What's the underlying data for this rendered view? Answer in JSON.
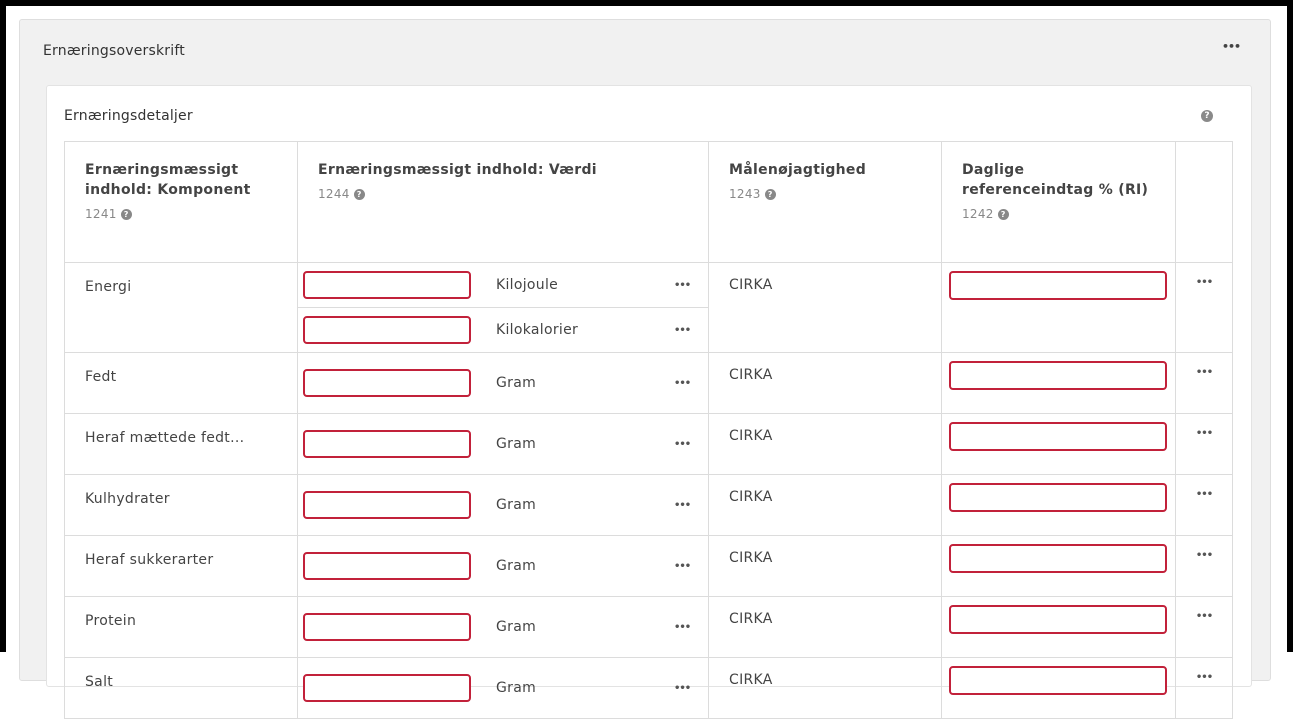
{
  "outer_section": {
    "title": "Ernæringsoverskrift",
    "more_icon": "more-icon"
  },
  "details": {
    "title": "Ernæringsdetaljer",
    "help_icon": "question-circle-icon"
  },
  "table": {
    "headers": [
      {
        "label": "Ernæringsmæssigt indhold: Komponent",
        "code": "1241"
      },
      {
        "label": "Ernæringsmæssigt indhold: Værdi",
        "code": "1244"
      },
      {
        "label": "Målenøjagtighed",
        "code": "1243"
      },
      {
        "label": "Daglige referenceindtag % (RI)",
        "code": "1242"
      }
    ],
    "rows": [
      {
        "component": "Energi",
        "values": [
          {
            "value": "",
            "unit": "Kilojoule"
          },
          {
            "value": "",
            "unit": "Kilokalorier"
          }
        ],
        "precision": "CIRKA",
        "ri": ""
      },
      {
        "component": "Fedt",
        "values": [
          {
            "value": "",
            "unit": "Gram"
          }
        ],
        "precision": "CIRKA",
        "ri": ""
      },
      {
        "component": "Heraf mættede fedt...",
        "values": [
          {
            "value": "",
            "unit": "Gram"
          }
        ],
        "precision": "CIRKA",
        "ri": ""
      },
      {
        "component": "Kulhydrater",
        "values": [
          {
            "value": "",
            "unit": "Gram"
          }
        ],
        "precision": "CIRKA",
        "ri": ""
      },
      {
        "component": "Heraf sukkerarter",
        "values": [
          {
            "value": "",
            "unit": "Gram"
          }
        ],
        "precision": "CIRKA",
        "ri": ""
      },
      {
        "component": "Protein",
        "values": [
          {
            "value": "",
            "unit": "Gram"
          }
        ],
        "precision": "CIRKA",
        "ri": ""
      },
      {
        "component": "Salt",
        "values": [
          {
            "value": "",
            "unit": "Gram"
          }
        ],
        "precision": "CIRKA",
        "ri": ""
      }
    ]
  },
  "colors": {
    "input_border_invalid": "#c2213a",
    "panel_bg": "#f1f1f1",
    "table_border": "#dcdcdc"
  }
}
